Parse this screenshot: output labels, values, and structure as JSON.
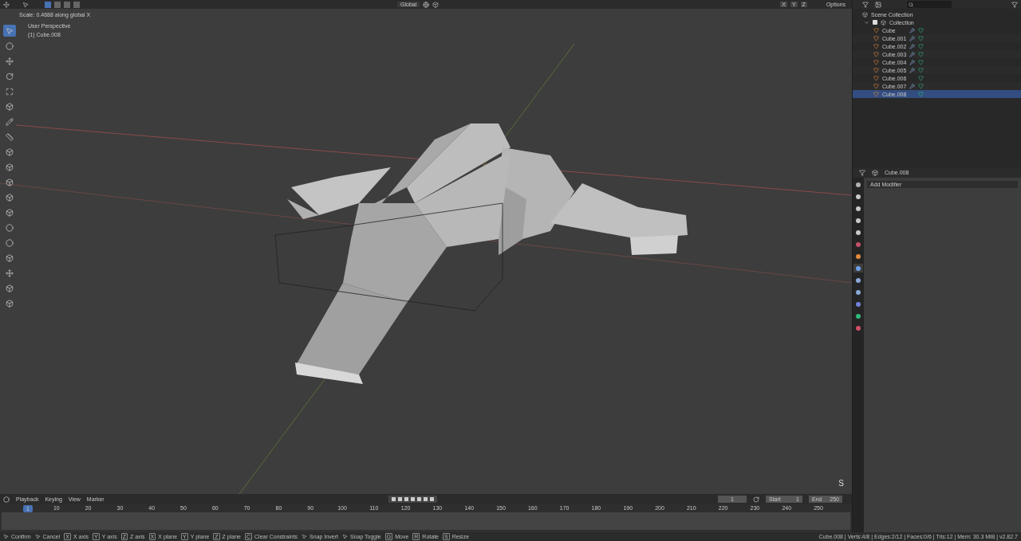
{
  "header": {
    "orientation": "Global",
    "options": "Options",
    "axes": [
      "X",
      "Y",
      "Z"
    ]
  },
  "viewport": {
    "operator": "Scale: 0.4688 along global X",
    "view": "User Perspective",
    "object": "(1) Cube.008",
    "key": "S"
  },
  "tools": [
    {
      "selected": true
    },
    {
      "selected": false
    },
    {
      "selected": false
    },
    {
      "selected": false
    },
    {
      "selected": false
    },
    {
      "selected": false
    },
    {
      "selected": false
    },
    {
      "selected": false
    },
    {
      "selected": false
    },
    {
      "selected": false
    },
    {
      "selected": false
    },
    {
      "selected": false
    },
    {
      "selected": false
    },
    {
      "selected": false
    },
    {
      "selected": false
    },
    {
      "selected": false
    },
    {
      "selected": false
    },
    {
      "selected": false
    },
    {
      "selected": false
    }
  ],
  "outliner": {
    "root": "Scene Collection",
    "collection": {
      "label": "Collection",
      "expanded": true,
      "checked": true,
      "children": [
        {
          "label": "Cube",
          "modifier": true,
          "selected": false
        },
        {
          "label": "Cube.001",
          "modifier": true,
          "selected": false
        },
        {
          "label": "Cube.002",
          "modifier": true,
          "selected": false
        },
        {
          "label": "Cube.003",
          "modifier": true,
          "selected": false
        },
        {
          "label": "Cube.004",
          "modifier": true,
          "selected": false
        },
        {
          "label": "Cube.005",
          "modifier": true,
          "selected": false
        },
        {
          "label": "Cube.006",
          "modifier": false,
          "selected": false
        },
        {
          "label": "Cube.007",
          "modifier": true,
          "selected": false
        },
        {
          "label": "Cube.008",
          "modifier": false,
          "selected": true
        }
      ]
    }
  },
  "properties": {
    "object": "Cube.008",
    "add_modifier": "Add Modifier",
    "tabs": [
      {
        "color": "#b0b0b0",
        "selected": false
      },
      {
        "color": "#c8c8c8",
        "selected": false
      },
      {
        "color": "#c8c8c8",
        "selected": false
      },
      {
        "color": "#c8c8c8",
        "selected": false
      },
      {
        "color": "#c8c8c8",
        "selected": false
      },
      {
        "color": "#c0506a",
        "selected": false
      },
      {
        "color": "#e08a3c",
        "selected": false
      },
      {
        "color": "#6fa0e8",
        "selected": true
      },
      {
        "color": "#8aa8d8",
        "selected": false
      },
      {
        "color": "#8aa8d8",
        "selected": false
      },
      {
        "color": "#6f82d8",
        "selected": false
      },
      {
        "color": "#2fb87a",
        "selected": false
      },
      {
        "color": "#d05068",
        "selected": false
      }
    ]
  },
  "timeline": {
    "menus": [
      "Playback",
      "Keying",
      "View",
      "Marker"
    ],
    "current": "1",
    "start_label": "Start",
    "start": "1",
    "end_label": "End",
    "end": "250",
    "ticks": [
      "1",
      "10",
      "20",
      "30",
      "40",
      "50",
      "60",
      "70",
      "80",
      "90",
      "100",
      "110",
      "120",
      "130",
      "140",
      "150",
      "160",
      "170",
      "180",
      "190",
      "200",
      "210",
      "220",
      "230",
      "240",
      "250"
    ]
  },
  "status": {
    "hints": [
      {
        "label": "Confirm"
      },
      {
        "label": "Cancel"
      },
      {
        "key": "X",
        "label": "X axis"
      },
      {
        "key": "Y",
        "label": "Y axis"
      },
      {
        "key": "Z",
        "label": "Z axis"
      },
      {
        "key": "X",
        "label": "X plane"
      },
      {
        "key": "Y",
        "label": "Y plane"
      },
      {
        "key": "Z",
        "label": "Z plane"
      },
      {
        "key": "C",
        "label": "Clear Constraints"
      },
      {
        "label": "Snap Invert"
      },
      {
        "label": "Snap Toggle"
      },
      {
        "key": "G",
        "label": "Move"
      },
      {
        "key": "R",
        "label": "Rotate"
      },
      {
        "key": "S",
        "label": "Resize"
      }
    ],
    "stats": "Cube.008 | Verts:4/8 | Edges:2/12 | Faces:0/6 | Tris:12 | Mem: 30.3 MiB | v2.82.7"
  }
}
